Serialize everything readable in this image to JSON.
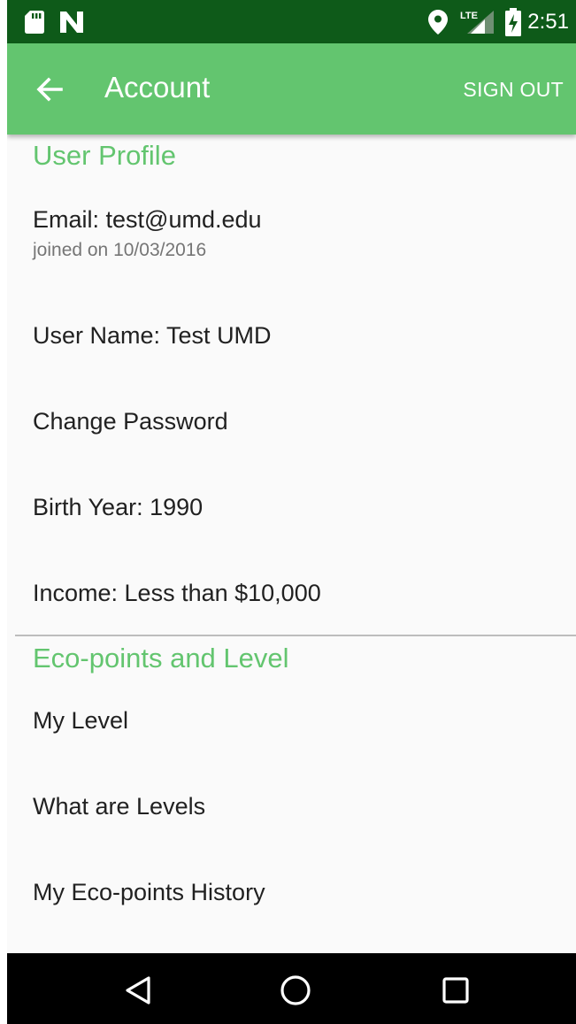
{
  "status_bar": {
    "time": "2:51",
    "left_icons": [
      "sd-card-icon",
      "n-logo-icon"
    ],
    "right_icons": [
      "location-icon",
      "lte-signal-icon",
      "battery-charging-icon"
    ],
    "network_label": "LTE"
  },
  "app_bar": {
    "title": "Account",
    "action": "SIGN OUT",
    "back_icon": "arrow-left-icon"
  },
  "sections": {
    "user_profile": {
      "title": "User Profile",
      "email": {
        "title": "Email: test@umd.edu",
        "summary": "joined on 10/03/2016"
      },
      "user_name": {
        "title": "User Name: Test UMD"
      },
      "change_password": {
        "title": "Change Password"
      },
      "birth_year": {
        "title": "Birth Year: 1990"
      },
      "income": {
        "title": "Income: Less than $10,000"
      }
    },
    "eco_points": {
      "title": "Eco-points and Level",
      "my_level": {
        "title": "My Level"
      },
      "what_are_levels": {
        "title": "What are Levels"
      },
      "history": {
        "title": "My Eco-points History"
      }
    }
  },
  "nav_bar": {
    "buttons": [
      "back-triangle-icon",
      "home-circle-icon",
      "recents-square-icon"
    ]
  },
  "colors": {
    "status_bar": "#0e5a19",
    "app_bar": "#63c56f",
    "accent": "#63c56f",
    "background": "#fafafa",
    "primary_text": "#212121",
    "secondary_text": "#757575",
    "nav_bar": "#000000"
  }
}
